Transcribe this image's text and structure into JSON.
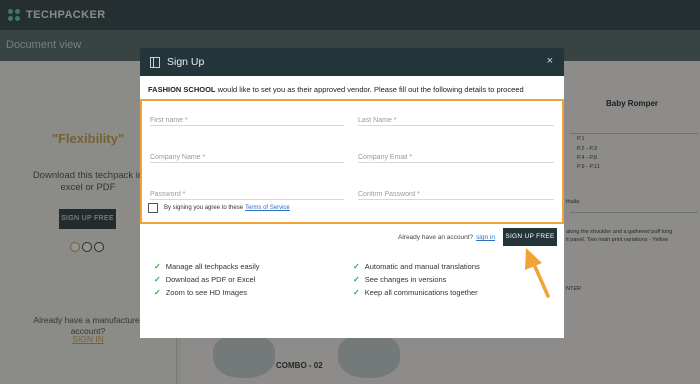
{
  "app": {
    "brand": "TECHPACKER"
  },
  "background": {
    "doc_bar_title": "Document view",
    "left_panel": {
      "heading": "\"Flexibility\"",
      "download_text": "Download this techpack in excel or PDF",
      "signup_button": "SIGN UP FREE",
      "manufacturer_text": "Already have a manufacturer account?",
      "signin_link": "SIGN IN"
    },
    "right_panel": {
      "product_title": "Baby Romper",
      "page_refs": [
        "P.1",
        "P.2 - P.3",
        "P.4 - P.8",
        "P.9 - P.11"
      ],
      "snippet_1": "thalia",
      "snippet_2": "along the shoulder and a gathered puff long",
      "snippet_3": "it panel. Two main print variations - Yellow",
      "snippet_4": "NTER",
      "combo_label": "COMBO - 02"
    }
  },
  "modal": {
    "title": "Sign Up",
    "close_glyph": "×",
    "intro_bold": "FASHION SCHOOL",
    "intro_rest": " would like to set you as their approved vendor. Please fill out the following details to proceed",
    "fields": {
      "first_name": "First name *",
      "last_name": "Last Name *",
      "company_name": "Company Name *",
      "company_email": "Company Email *",
      "password": "Password *",
      "confirm_password": "Confirm Password *"
    },
    "agree_text": "By signing you agree to these",
    "terms_link": "Terms of Service",
    "have_account": "Already have an account?",
    "signin_link": "sign in",
    "signup_button": "SIGN UP FREE",
    "features_left": [
      "Manage all techpacks easily",
      "Download as PDF or Excel",
      "Zoom to see HD Images"
    ],
    "features_right": [
      "Automatic and manual translations",
      "See changes in versions",
      "Keep all communications together"
    ],
    "check_glyph": "✓"
  },
  "colors": {
    "header_dark": "#243539",
    "highlight_orange": "#f0a437",
    "accent_gold": "#c7a24a",
    "check_green": "#3aa64a",
    "link_blue": "#2f6fbf"
  }
}
